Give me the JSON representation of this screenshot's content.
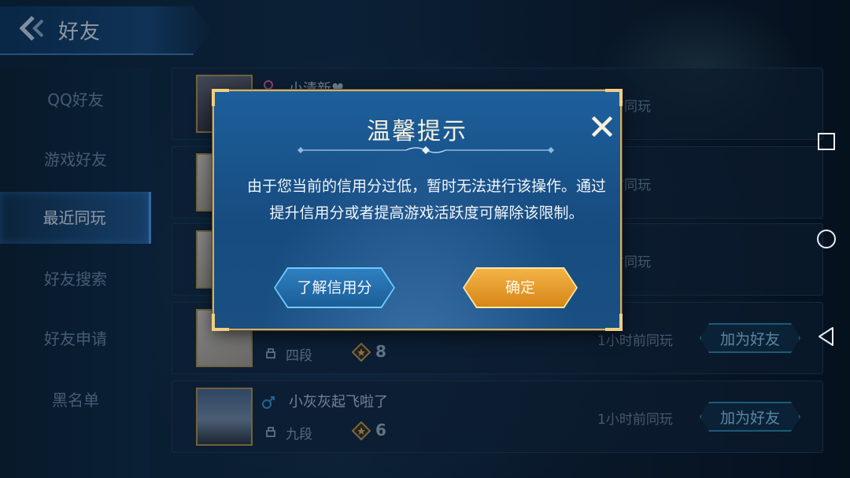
{
  "header": {
    "title": "好友",
    "back_icon": "back-arrow-icon"
  },
  "sidebar": {
    "items": [
      {
        "label": "QQ好友"
      },
      {
        "label": "游戏好友"
      },
      {
        "label": "最近同玩",
        "active": true
      },
      {
        "label": "好友搜索"
      },
      {
        "label": "好友申请"
      },
      {
        "label": "黑名单"
      }
    ]
  },
  "friends": [
    {
      "name": "小清新♥",
      "time": "钟前同玩"
    },
    {
      "name": "",
      "time": "钟前同玩"
    },
    {
      "name": "",
      "time": "钟前同玩"
    },
    {
      "name": "",
      "rank": "四段",
      "level": "8",
      "time": "1小时前同玩",
      "add_label": "加为好友"
    },
    {
      "name": "小灰灰起飞啦了",
      "rank": "九段",
      "level": "6",
      "time": "1小时前同玩",
      "add_label": "加为好友"
    }
  ],
  "dialog": {
    "title": "温馨提示",
    "close_symbol": "X",
    "message": "由于您当前的信用分过低，暂时无法进行该操作。通过提升信用分或者提高游戏活跃度可解除该限制。",
    "learn_button": "了解信用分",
    "ok_button": "确定"
  },
  "colors": {
    "accent_blue": "#4da6ff",
    "dialog_gold": "#d1b06a",
    "ok_orange": "#e99a2c",
    "male_blue": "#3b9ae1"
  }
}
